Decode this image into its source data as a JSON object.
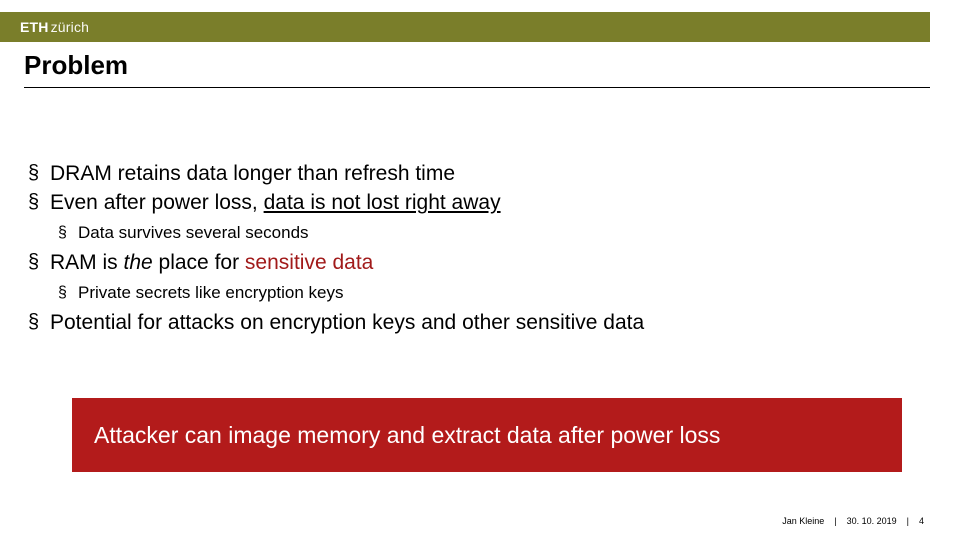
{
  "brand": {
    "strong": "ETH",
    "light": "zürich"
  },
  "title": "Problem",
  "bullets": {
    "b1": "DRAM retains data longer than refresh time",
    "b2_pre": "Even after power loss, ",
    "b2_under": "data is not lost right away",
    "b2_sub1": "Data survives several seconds",
    "b3_pre": "RAM is ",
    "b3_em": "the",
    "b3_mid": " place for ",
    "b3_hl": "sensitive data",
    "b3_sub1": "Private secrets like encryption keys",
    "b4": "Potential for attacks on encryption keys and other sensitive data"
  },
  "callout": "Attacker can image memory and extract data after power loss",
  "footer": {
    "author": "Jan Kleine",
    "date": "30. 10. 2019",
    "page": "4"
  }
}
